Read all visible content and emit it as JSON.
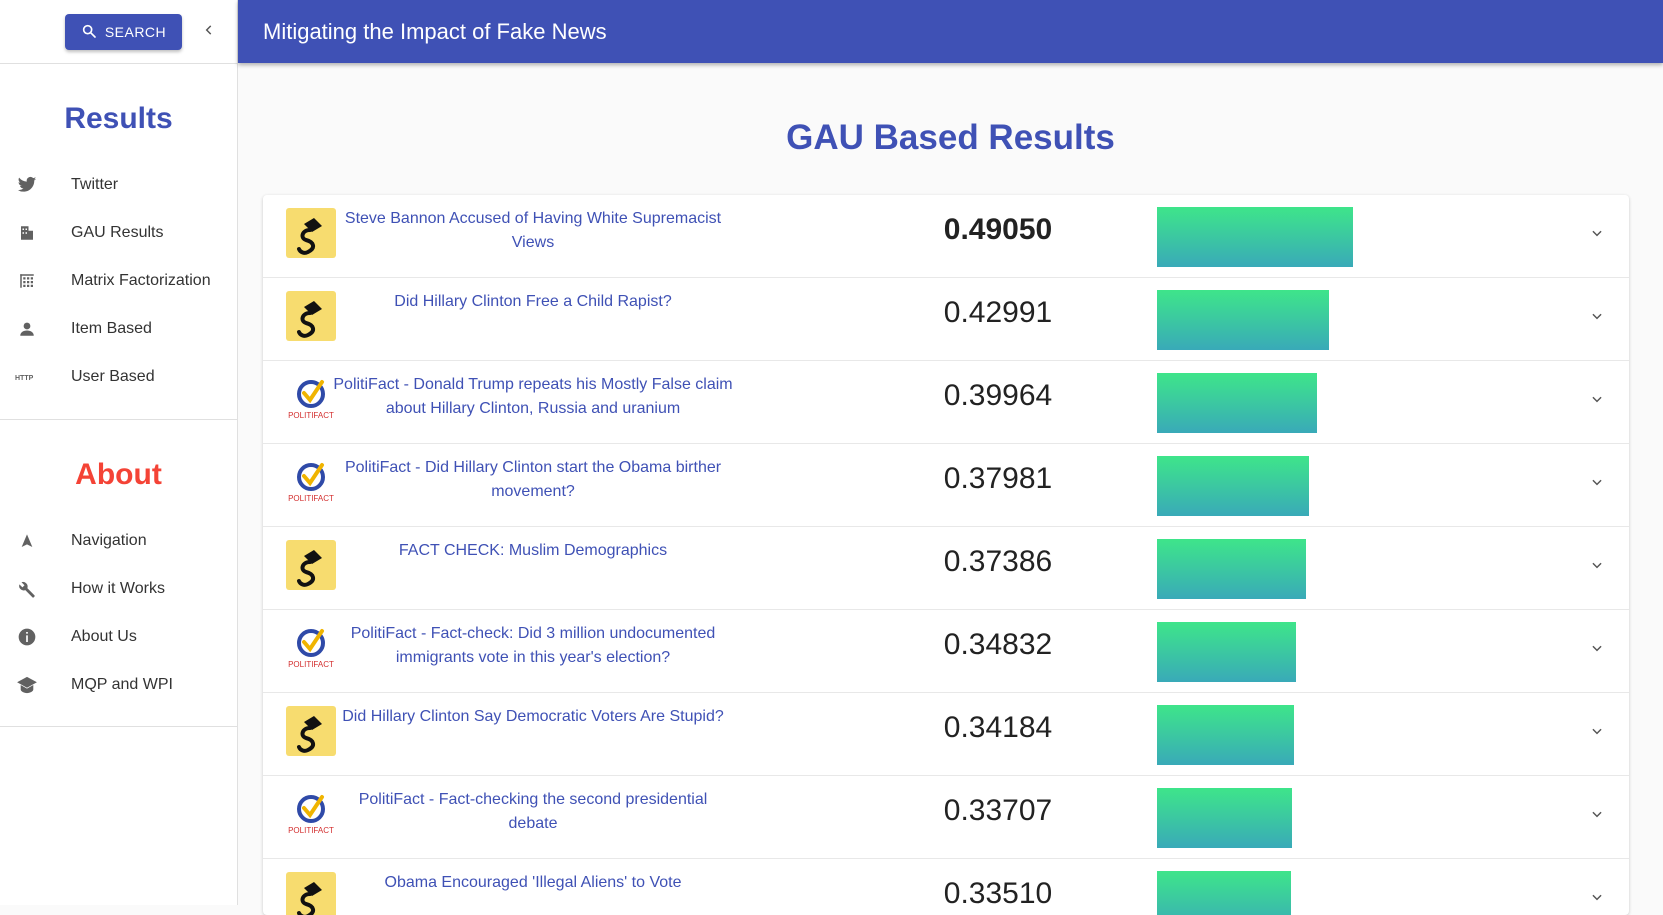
{
  "sidebar": {
    "search_label": "SEARCH",
    "results_title": "Results",
    "results_items": [
      {
        "label": "Twitter",
        "icon": "twitter-icon"
      },
      {
        "label": "GAU Results",
        "icon": "building-icon"
      },
      {
        "label": "Matrix Factorization",
        "icon": "grid-icon"
      },
      {
        "label": "Item Based",
        "icon": "person-icon"
      },
      {
        "label": "User Based",
        "icon": "http-icon"
      }
    ],
    "about_title": "About",
    "about_items": [
      {
        "label": "Navigation",
        "icon": "navigation-arrow-icon"
      },
      {
        "label": "How it Works",
        "icon": "wrench-icon"
      },
      {
        "label": "About Us",
        "icon": "info-icon"
      },
      {
        "label": "MQP and WPI",
        "icon": "graduation-cap-icon"
      }
    ]
  },
  "appbar": {
    "title": "Mitigating the Impact of Fake News"
  },
  "main": {
    "title": "GAU Based Results"
  },
  "results": [
    {
      "title": "Steve Bannon Accused of Having White Supremacist Views",
      "score": "0.49050",
      "value": 0.4905,
      "source": "snopes"
    },
    {
      "title": "Did Hillary Clinton Free a Child Rapist?",
      "score": "0.42991",
      "value": 0.42991,
      "source": "snopes"
    },
    {
      "title": "PolitiFact - Donald Trump repeats his Mostly False claim about Hillary Clinton, Russia and uranium",
      "score": "0.39964",
      "value": 0.39964,
      "source": "politifact"
    },
    {
      "title": "PolitiFact - Did Hillary Clinton start the Obama birther movement?",
      "score": "0.37981",
      "value": 0.37981,
      "source": "politifact"
    },
    {
      "title": "FACT CHECK: Muslim Demographics",
      "score": "0.37386",
      "value": 0.37386,
      "source": "snopes"
    },
    {
      "title": "PolitiFact - Fact-check: Did 3 million undocumented immigrants vote in this year's election?",
      "score": "0.34832",
      "value": 0.34832,
      "source": "politifact"
    },
    {
      "title": "Did Hillary Clinton Say Democratic Voters Are Stupid?",
      "score": "0.34184",
      "value": 0.34184,
      "source": "snopes"
    },
    {
      "title": "PolitiFact - Fact-checking the second presidential debate",
      "score": "0.33707",
      "value": 0.33707,
      "source": "politifact"
    },
    {
      "title": "Obama Encouraged 'Illegal Aliens' to Vote",
      "score": "0.33510",
      "value": 0.3351,
      "source": "snopes"
    }
  ],
  "politifact_logo_text": "POLITIFACT",
  "colors": {
    "primary": "#3f51b5",
    "about": "#f44336",
    "bar_top": "#3ee58a",
    "bar_bottom": "#39aab8"
  }
}
